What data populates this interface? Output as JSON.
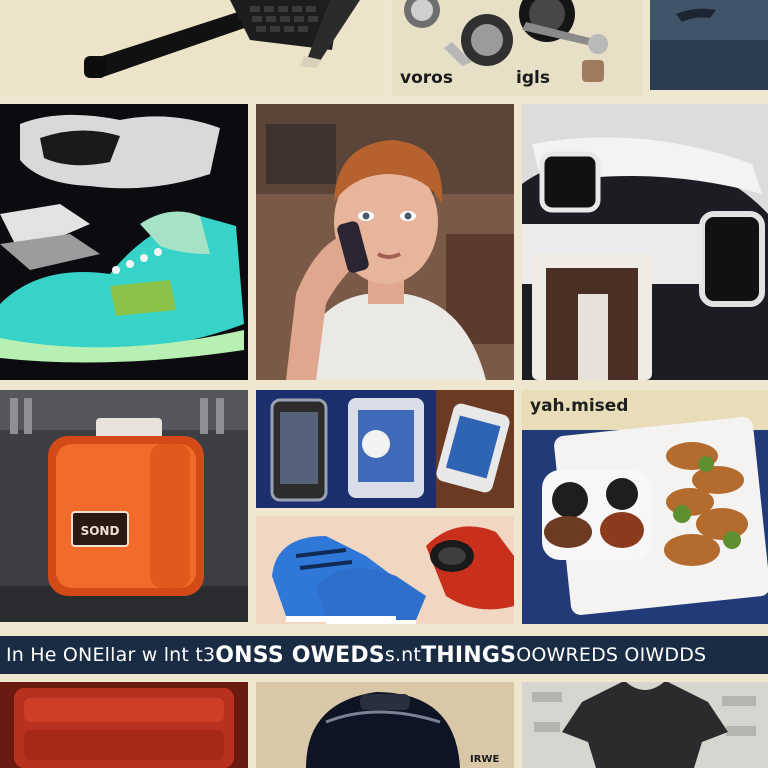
{
  "captions": {
    "goggles_left": "voros",
    "goggles_right": "igls",
    "tray_label": "yah.mised"
  },
  "banner": {
    "part1": "In He ONEllar w lnt t3 ",
    "part2": "ONSS OWEDS",
    "part3": " s.nt ",
    "part4": "THINGS",
    "part5": " OOWREDS OIWDDS"
  },
  "product_label": "SOND",
  "bottom_caption": "IRWE"
}
